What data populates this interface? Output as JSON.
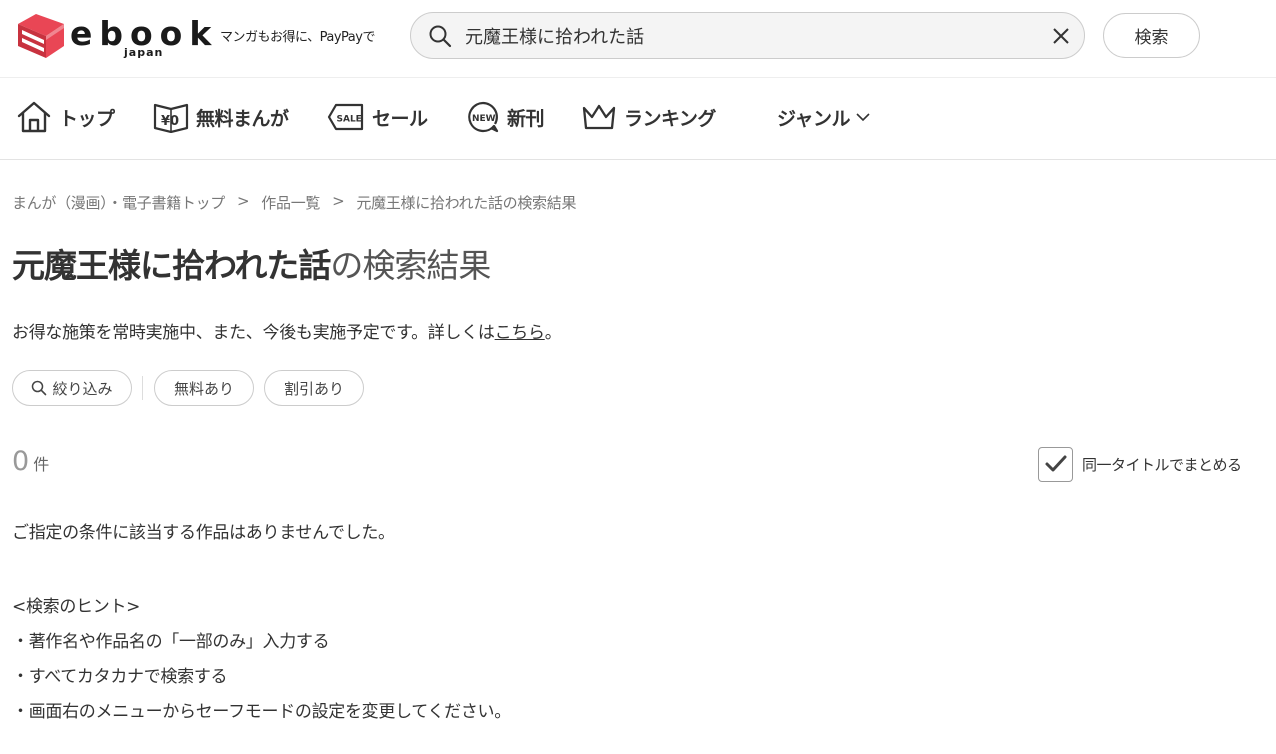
{
  "header": {
    "logo_text": "ebook",
    "logo_subtext": "japan",
    "tagline": "マンガもお得に、PayPayで",
    "search": {
      "value": "元魔王様に拾われた話",
      "placeholder": ""
    },
    "search_button_label": "検索"
  },
  "nav": {
    "items": [
      {
        "label": "トップ",
        "icon": "home-icon"
      },
      {
        "label": "無料まんが",
        "icon": "free-yen-icon"
      },
      {
        "label": "セール",
        "icon": "sale-tag-icon"
      },
      {
        "label": "新刊",
        "icon": "new-badge-icon"
      },
      {
        "label": "ランキング",
        "icon": "crown-icon"
      },
      {
        "label": "ジャンル",
        "icon": "chevron-down-icon"
      }
    ]
  },
  "breadcrumb": {
    "items": [
      "まんが（漫画）・電子書籍トップ",
      "作品一覧",
      "元魔王様に拾われた話の検索結果"
    ],
    "separator": ">"
  },
  "page": {
    "title_query": "元魔王様に拾われた話",
    "title_suffix": "の検索結果",
    "notice_text": "お得な施策を常時実施中、また、今後も実施予定です。詳しくは",
    "notice_link": "こちら",
    "notice_end": "。"
  },
  "filters": {
    "items": [
      {
        "label": "絞り込み",
        "icon": "search-icon"
      },
      {
        "label": "無料あり"
      },
      {
        "label": "割引あり"
      }
    ]
  },
  "results": {
    "count": "0",
    "count_unit": "件",
    "group_same_title": {
      "label": "同一タイトルでまとめる",
      "checked": true
    },
    "empty_message": "ご指定の条件に該当する作品はありませんでした。",
    "hints": [
      "<検索のヒント>",
      "・著作名や作品名の「一部のみ」入力する",
      "・すべてカタカナで検索する",
      "・画面右のメニューからセーフモードの設定を変更してください。"
    ]
  },
  "colors": {
    "logo_red": "#e94655",
    "text": "#333333",
    "muted": "#777777",
    "border": "#cccccc"
  }
}
